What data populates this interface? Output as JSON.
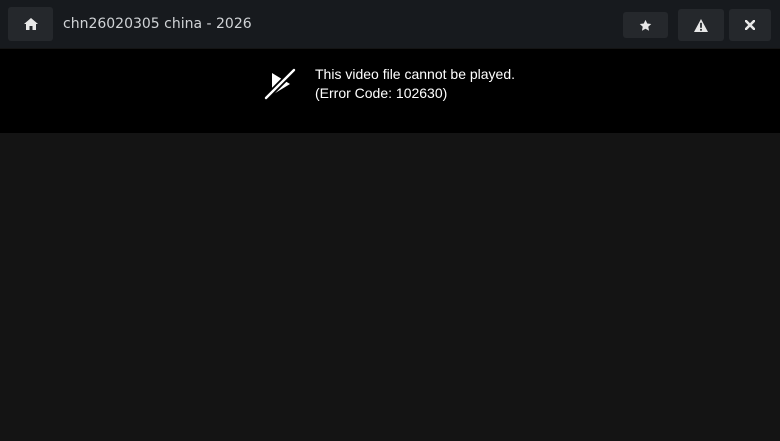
{
  "header": {
    "title": "chn26020305 china - 2026",
    "buttons": {
      "home": "home-icon",
      "favorite": "star-icon",
      "report": "warning-icon",
      "close": "close-icon"
    }
  },
  "player": {
    "error_message": "This video file cannot be played.",
    "error_code": "(Error Code: 102630)",
    "icon": "video-off-icon"
  },
  "colors": {
    "topbar_bg": "#171a1e",
    "button_bg": "#25282c",
    "player_bg": "#000000",
    "page_bg": "#141414",
    "icon_color": "#e8e8e8"
  }
}
